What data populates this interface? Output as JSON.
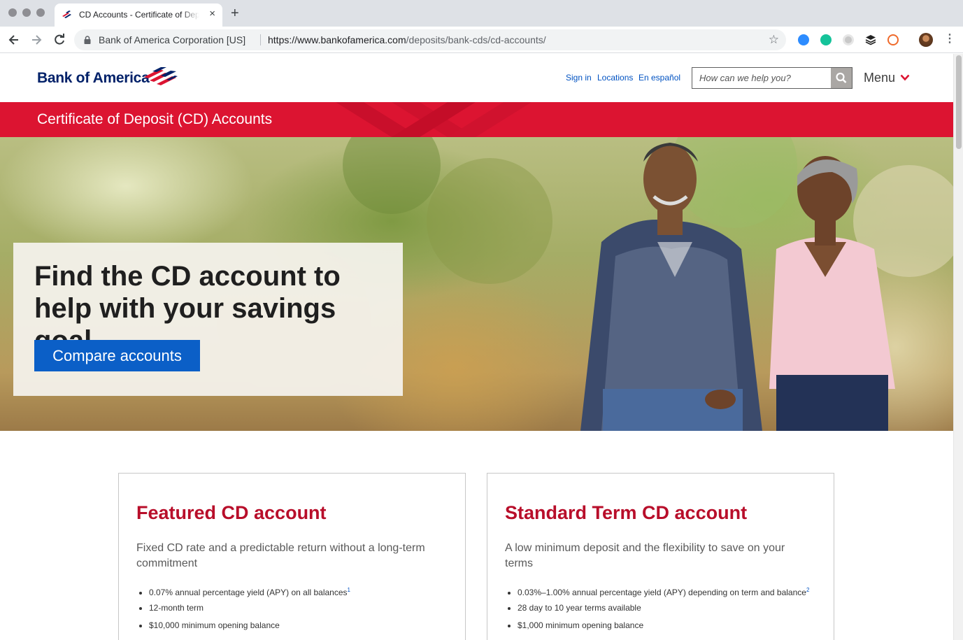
{
  "browser": {
    "tab": {
      "title": "CD Accounts - Certificate of Deposit Accounts from Bank of America",
      "close": "×"
    },
    "new_tab": "+",
    "address": {
      "site_identity": "Bank of America Corporation [US]",
      "url_host": "https://www.bankofamerica.com",
      "url_path": "/deposits/bank-cds/cd-accounts/"
    },
    "extension_icons": [
      "zoom-extension-icon",
      "grammarly-icon",
      "gray-circle-extension-icon",
      "buffer-icon",
      "honey-icon",
      "profile-avatar"
    ],
    "menu": "⋮"
  },
  "header": {
    "logo_text": "Bank of America",
    "links": {
      "sign_in": "Sign in",
      "locations": "Locations",
      "espanol": "En español"
    },
    "search": {
      "placeholder": "How can we help you?"
    },
    "menu_label": "Menu"
  },
  "banner": {
    "title": "Certificate of Deposit (CD) Accounts"
  },
  "hero": {
    "heading": "Find the CD account to help with your savings goal",
    "cta": "Compare accounts"
  },
  "cards": [
    {
      "title": "Featured CD account",
      "subtitle": "Fixed CD rate and a predictable return without a long-term commitment",
      "bullets": [
        {
          "text": "0.07% annual percentage yield (APY) on all balances",
          "footnote": "1"
        },
        {
          "text": "12-month term",
          "footnote": ""
        },
        {
          "text": "$10,000 minimum opening balance",
          "footnote": ""
        }
      ]
    },
    {
      "title": "Standard Term CD account",
      "subtitle": "A low minimum deposit and the flexibility to save on your terms",
      "bullets": [
        {
          "text": "0.03%–1.00% annual percentage yield (APY) depending on term and balance",
          "footnote": "2"
        },
        {
          "text": "28 day to 10 year terms available",
          "footnote": ""
        },
        {
          "text": "$1,000 minimum opening balance",
          "footnote": ""
        }
      ]
    }
  ],
  "colors": {
    "brand_red": "#dc1431",
    "brand_navy": "#012169",
    "cta_blue": "#0b5fc7",
    "title_red": "#b80e2a",
    "link_blue": "#0052c2"
  }
}
